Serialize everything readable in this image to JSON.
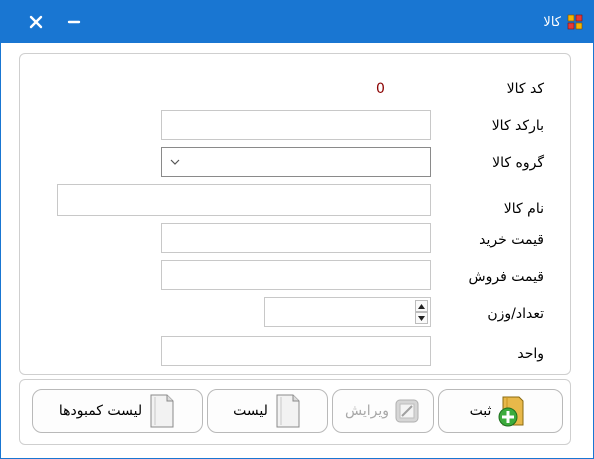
{
  "window": {
    "title": "کالا",
    "close_glyph": "✕",
    "minimize_glyph": "–"
  },
  "form": {
    "code_label": "کد کالا",
    "code_value": "0",
    "barcode_label": "بارکد کالا",
    "barcode_value": "",
    "group_label": "گروه کالا",
    "group_value": "",
    "name_label": "نام کالا",
    "name_value": "",
    "buy_price_label": "قیمت خرید",
    "buy_price_value": "",
    "sell_price_label": "قیمت فروش",
    "sell_price_value": "",
    "count_label": "تعداد/وزن",
    "count_value": "",
    "unit_label": "واحد",
    "unit_value": ""
  },
  "buttons": {
    "submit": "ثبت",
    "edit": "ویرایش",
    "list": "لیست",
    "shortage_list": "لیست کمبودها"
  },
  "colors": {
    "titlebar": "#1976d2",
    "code_value": "#8b0000",
    "disabled_text": "#a8a8a8"
  }
}
